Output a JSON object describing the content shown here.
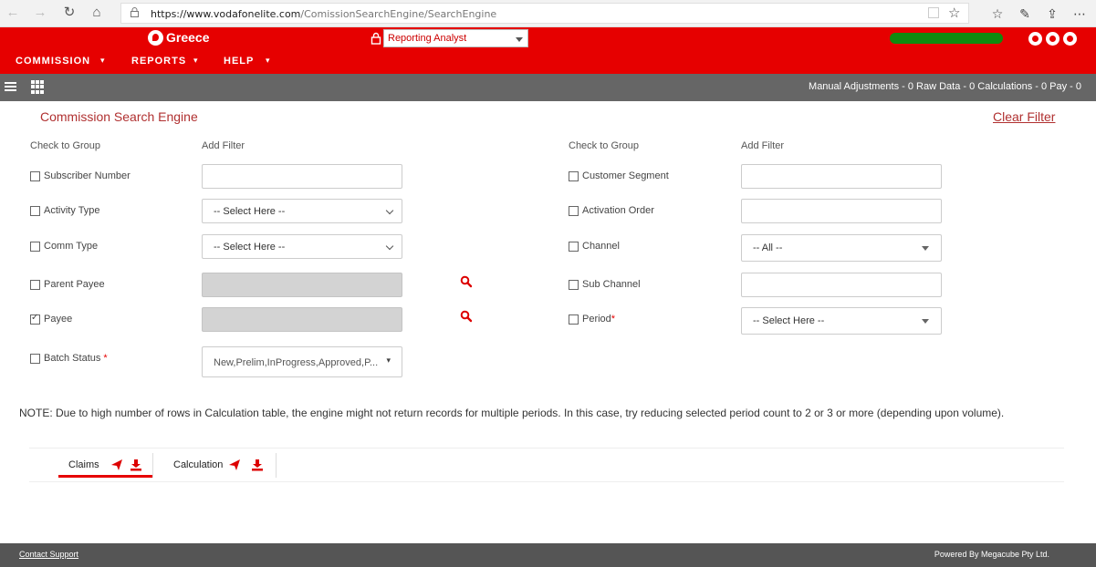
{
  "browser": {
    "url_host": "https://www.vodafonelite.com",
    "url_path": "/ComissionSearchEngine/SearchEngine"
  },
  "header": {
    "brand": "Greece",
    "role": "Reporting Analyst"
  },
  "menu": {
    "items": [
      "COMMISSION",
      "REPORTS",
      "HELP"
    ]
  },
  "toolbar": {
    "summary": "Manual Adjustments - 0  Raw Data - 0  Calculations - 0  Pay - 0"
  },
  "page": {
    "title": "Commission Search Engine",
    "clear_filter": "Clear Filter"
  },
  "columns": {
    "check_to_group": "Check to Group",
    "add_filter": "Add Filter"
  },
  "left_filters": [
    {
      "label": "Subscriber Number",
      "checked": false,
      "value": ""
    },
    {
      "label": "Activity Type",
      "checked": false,
      "value": "-- Select Here --"
    },
    {
      "label": "Comm Type",
      "checked": false,
      "value": "-- Select Here --"
    },
    {
      "label": "Parent Payee",
      "checked": false,
      "value": ""
    },
    {
      "label": "Payee",
      "checked": true,
      "value": ""
    },
    {
      "label": "Batch Status",
      "checked": false,
      "value": "New,Prelim,InProgress,Approved,P..."
    }
  ],
  "right_filters": [
    {
      "label": "Customer Segment",
      "checked": false,
      "value": ""
    },
    {
      "label": "Activation Order",
      "checked": false,
      "value": ""
    },
    {
      "label": "Channel",
      "checked": false,
      "value": "-- All --"
    },
    {
      "label": "Sub Channel",
      "checked": false,
      "value": ""
    },
    {
      "label": "Period",
      "checked": false,
      "value": "-- Select Here --"
    }
  ],
  "required_mark": "*",
  "note": "NOTE: Due to high number of rows in Calculation table, the engine might not return records for multiple periods. In this case, try reducing selected period count to 2 or 3 or more (depending upon volume).",
  "tabs": [
    "Claims",
    "Calculation"
  ],
  "footer": {
    "contact": "Contact Support",
    "powered": "Powered By Megacube Pty Ltd."
  },
  "colors": {
    "brand_red": "#e60000",
    "toolbar_gray": "#666666",
    "footer_gray": "#555555"
  }
}
